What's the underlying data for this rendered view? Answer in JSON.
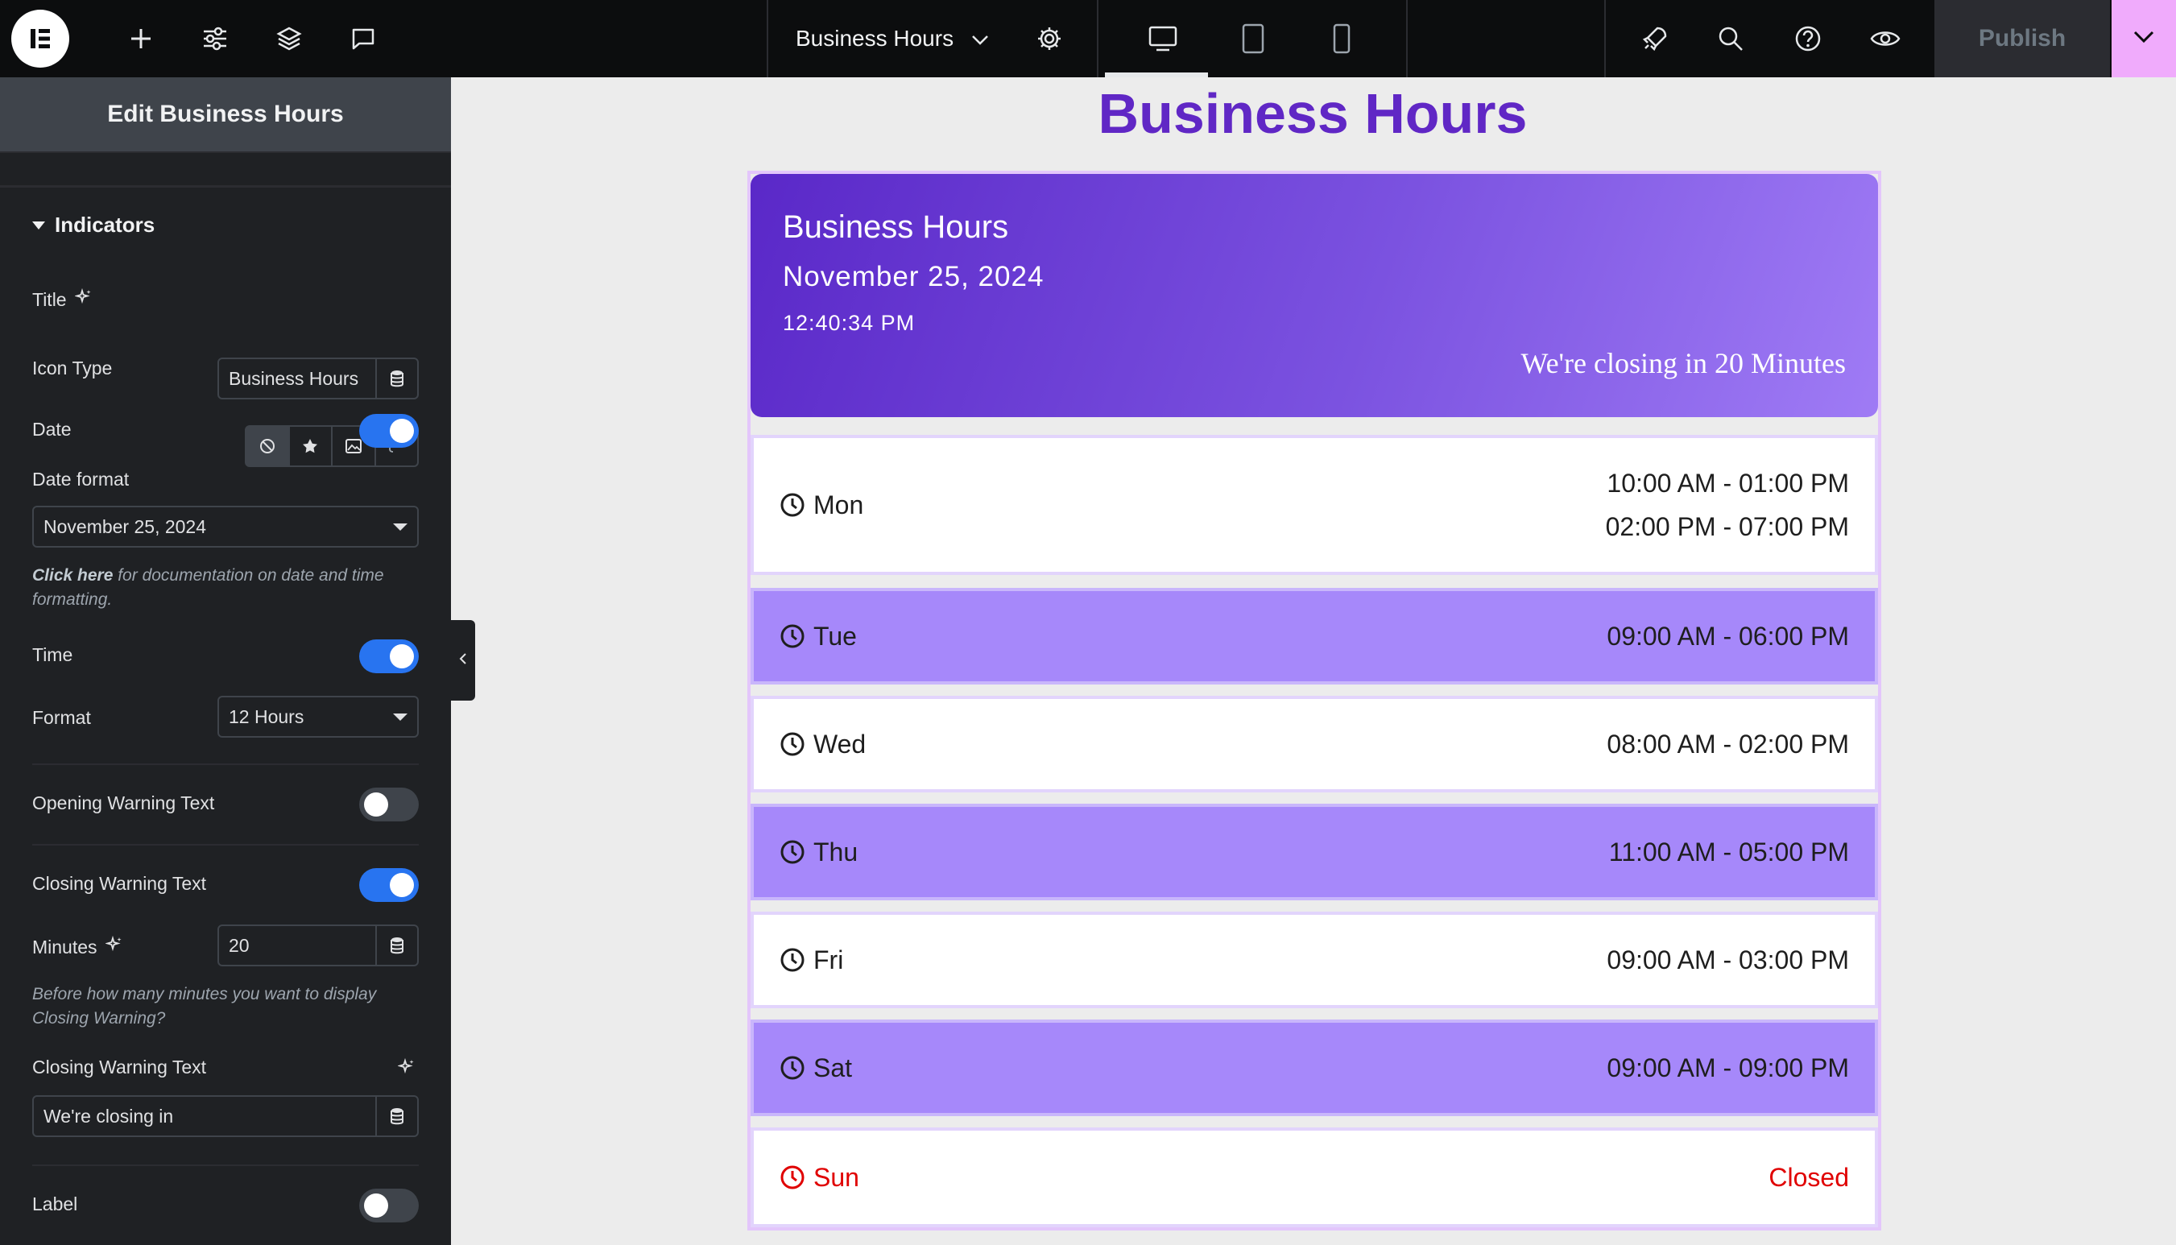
{
  "topbar": {
    "document_title": "Business Hours",
    "publish_label": "Publish",
    "icons": [
      "elementor-logo-icon",
      "plus-icon",
      "sliders-icon",
      "layers-icon",
      "comment-icon",
      "chevron-down-icon",
      "gear-icon",
      "desktop-icon",
      "tablet-icon",
      "mobile-icon",
      "rocket-icon",
      "search-icon",
      "help-icon",
      "eye-icon"
    ]
  },
  "panel": {
    "header_title": "Edit Business Hours",
    "section_title": "Indicators",
    "title_label": "Title",
    "title_value": "Business Hours",
    "icon_type_label": "Icon Type",
    "date_label": "Date",
    "date_toggle": true,
    "date_format_label": "Date format",
    "date_format_value": "November 25, 2024",
    "note_link": "Click here",
    "note_text": " for documentation on date and time formatting.",
    "time_label": "Time",
    "time_toggle": true,
    "format_label": "Format",
    "format_value": "12 Hours",
    "opening_warning_label": "Opening Warning Text",
    "opening_warning_toggle": false,
    "closing_warning_label": "Closing Warning Text",
    "closing_warning_toggle": true,
    "minutes_label": "Minutes",
    "minutes_value": "20",
    "minutes_note": "Before how many minutes you want to display Closing Warning?",
    "closing_text_label": "Closing Warning Text",
    "closing_text_value": "We're closing in",
    "label_label": "Label",
    "label_toggle": false
  },
  "canvas": {
    "page_heading": "Business Hours",
    "card_title": "Business Hours",
    "card_date": "November 25, 2024",
    "card_time": "12:40:34 PM",
    "card_warning": "We're closing in 20 Minutes",
    "days": [
      {
        "day": "Mon",
        "hours": [
          "10:00 AM - 01:00 PM",
          "02:00 PM - 07:00 PM"
        ]
      },
      {
        "day": "Tue",
        "hours": [
          "09:00 AM - 06:00 PM"
        ]
      },
      {
        "day": "Wed",
        "hours": [
          "08:00 AM - 02:00 PM"
        ]
      },
      {
        "day": "Thu",
        "hours": [
          "11:00 AM - 05:00 PM"
        ]
      },
      {
        "day": "Fri",
        "hours": [
          "09:00 AM - 03:00 PM"
        ]
      },
      {
        "day": "Sat",
        "hours": [
          "09:00 AM - 09:00 PM"
        ]
      },
      {
        "day": "Sun",
        "hours": [
          "Closed"
        ]
      }
    ]
  },
  "colors": {
    "accent_purple": "#6027c5",
    "row_purple": "#a688fa",
    "toggle_blue": "#2874f0",
    "closed_red": "#e00000",
    "publish_arrow": "#f0abfc"
  }
}
